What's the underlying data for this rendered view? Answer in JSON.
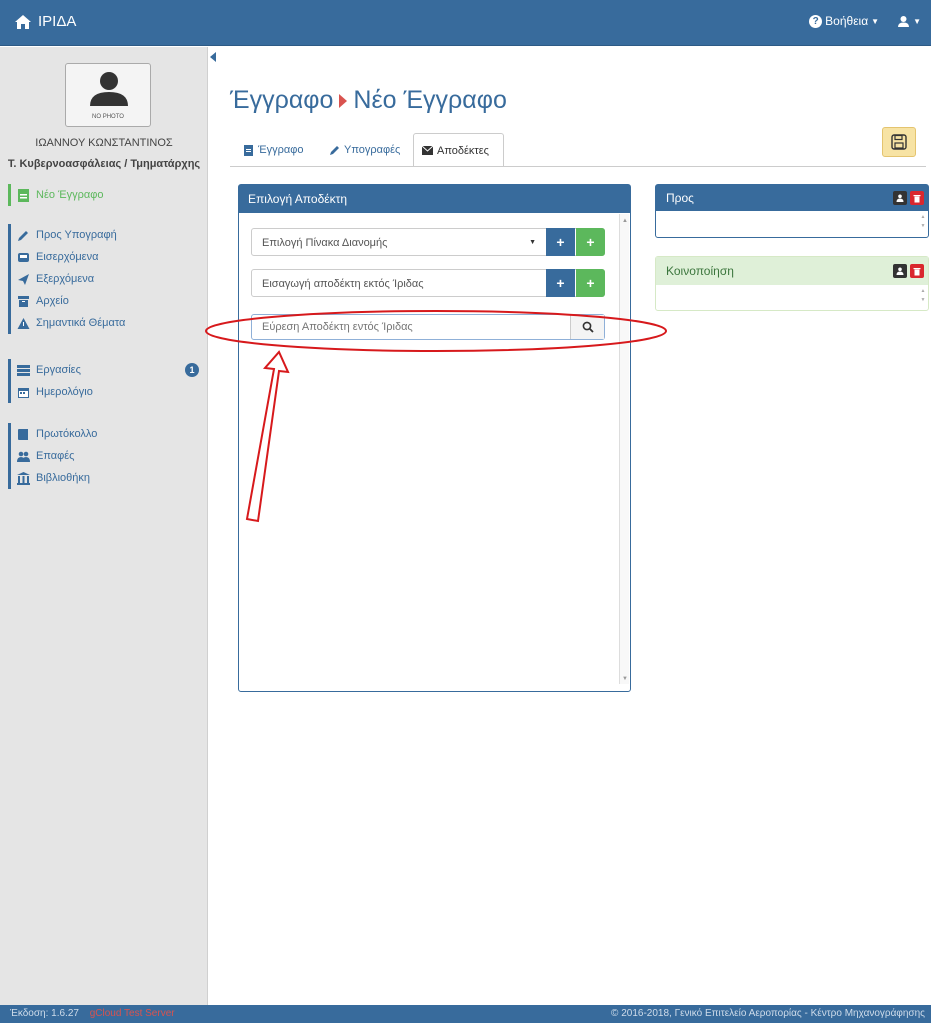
{
  "navbar": {
    "brand": "ΙΡΙΔΑ",
    "help_label": "Βοήθεια",
    "brand_color": "#386b9c"
  },
  "sidebar": {
    "avatar_caption": "NO PHOTO",
    "user_name": "ΙΩΑΝΝΟΥ ΚΩΝΣΤΑΝΤΙΝΟΣ",
    "user_role": "Τ. Κυβερνοασφάλειας / Τμηματάρχης",
    "new_document": "Νέο Έγγραφο",
    "group1": [
      {
        "label": "Προς Υπογραφή",
        "icon": "pencil-icon"
      },
      {
        "label": "Εισερχόμενα",
        "icon": "inbox-icon"
      },
      {
        "label": "Εξερχόμενα",
        "icon": "send-icon"
      },
      {
        "label": "Αρχείο",
        "icon": "archive-icon"
      },
      {
        "label": "Σημαντικά Θέματα",
        "icon": "warning-icon"
      }
    ],
    "group2": [
      {
        "label": "Εργασίες",
        "icon": "tasks-icon",
        "badge": "1"
      },
      {
        "label": "Ημερολόγιο",
        "icon": "calendar-icon"
      }
    ],
    "group3": [
      {
        "label": "Πρωτόκολλο",
        "icon": "book-icon"
      },
      {
        "label": "Επαφές",
        "icon": "users-icon"
      },
      {
        "label": "Βιβλιοθήκη",
        "icon": "library-icon"
      }
    ]
  },
  "main": {
    "title_part1": "Έγγραφο",
    "title_part2": "Νέο Έγγραφο",
    "tabs": [
      {
        "label": "Έγγραφο",
        "icon": "file-icon"
      },
      {
        "label": "Υπογραφές",
        "icon": "pencil-icon"
      },
      {
        "label": "Αποδέκτες",
        "icon": "envelope-icon",
        "active": true
      }
    ],
    "recipient_panel": {
      "title": "Επιλογή Αποδέκτη",
      "distribution_select": "Επιλογή Πίνακα Διανομής",
      "external_recipient": "Εισαγωγή αποδέκτη εκτός Ίριδας",
      "search_placeholder": "Εύρεση Αποδέκτη εντός Ίριδας"
    },
    "to_panel": {
      "title": "Προς"
    },
    "cc_panel": {
      "title": "Κοινοποίηση"
    }
  },
  "footer": {
    "version": "Έκδοση: 1.6.27",
    "server": "gCloud Test Server",
    "copyright": "© 2016-2018, Γενικό Επιτελείο Αεροπορίας - Κέντρο Μηχανογράφησης"
  }
}
